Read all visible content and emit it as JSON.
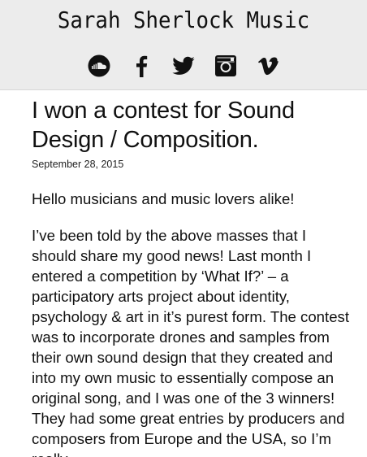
{
  "site": {
    "title": "Sarah Sherlock Music"
  },
  "social": [
    {
      "name": "soundcloud-icon"
    },
    {
      "name": "facebook-icon"
    },
    {
      "name": "twitter-icon"
    },
    {
      "name": "instagram-icon"
    },
    {
      "name": "vimeo-icon"
    }
  ],
  "post": {
    "title": "I won a contest for Sound Design / Composition.",
    "date": "September 28, 2015",
    "paragraphs": [
      "Hello musicians and music lovers alike!",
      "I’ve been told by the above masses that I should share my good news! Last month I entered a competition by ‘What If?’ – a participatory arts project about identity, psychology & art in it’s purest form. The contest was to incorporate drones and samples from their own sound design that they created and into my own music to essentially compose an original song, and I was one of the 3 winners! They had some great entries by producers and composers from Europe and the USA, so I’m really"
    ]
  }
}
